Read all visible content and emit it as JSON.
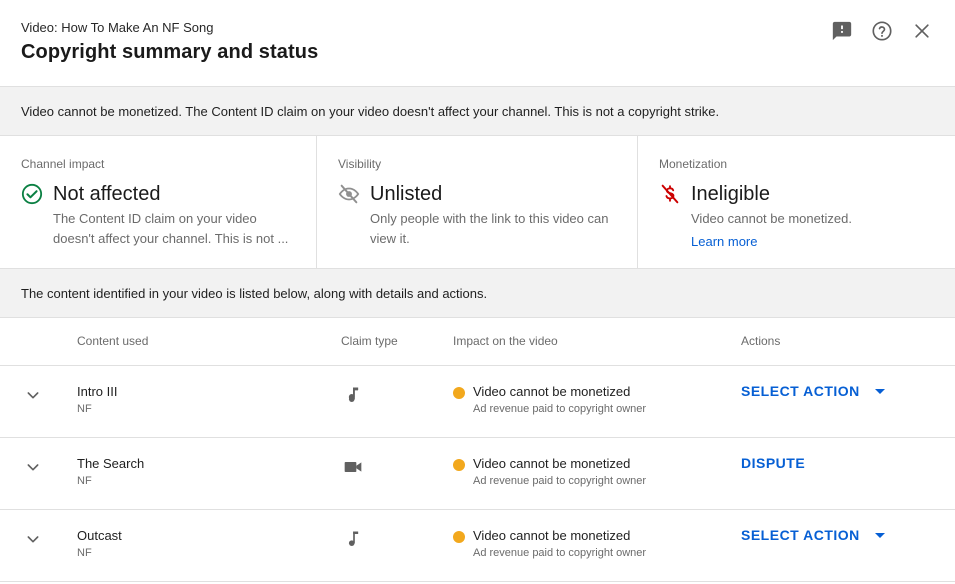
{
  "header": {
    "video_label": "Video: How To Make An NF Song",
    "title": "Copyright summary and status",
    "icons": [
      "feedback-icon",
      "help-icon",
      "close-icon"
    ]
  },
  "banner": {
    "text": "Video cannot be monetized. The Content ID claim on your video doesn't affect your channel. This is not a copyright strike."
  },
  "summary": {
    "channel": {
      "label": "Channel impact",
      "value": "Not affected",
      "desc": "The Content ID claim on your video doesn't affect your channel. This is not ...",
      "icon": "check-circle-icon",
      "icon_color": "#0b8043"
    },
    "visibility": {
      "label": "Visibility",
      "value": "Unlisted",
      "desc": "Only people with the link to this video can view it.",
      "icon": "eye-off-icon",
      "icon_color": "#909090"
    },
    "monetization": {
      "label": "Monetization",
      "value": "Ineligible",
      "desc": "Video cannot be monetized.",
      "link": "Learn more",
      "icon": "no-money-icon",
      "icon_color": "#cc0000"
    }
  },
  "content_band": {
    "text": "The content identified in your video is listed below, along with details and actions."
  },
  "table": {
    "headers": [
      "Content used",
      "Claim type",
      "Impact on the video",
      "Actions"
    ],
    "rows": [
      {
        "title": "Intro III",
        "artist": "NF",
        "claim_type": "audio-icon",
        "impact": "Video cannot be monetized",
        "impact_sub": "Ad revenue paid to copyright owner",
        "action": "SELECT ACTION",
        "has_dropdown": true
      },
      {
        "title": "The Search",
        "artist": "NF",
        "claim_type": "video-camera-icon",
        "impact": "Video cannot be monetized",
        "impact_sub": "Ad revenue paid to copyright owner",
        "action": "DISPUTE",
        "has_dropdown": false
      },
      {
        "title": "Outcast",
        "artist": "NF",
        "claim_type": "audio-icon",
        "impact": "Video cannot be monetized",
        "impact_sub": "Ad revenue paid to copyright owner",
        "action": "SELECT ACTION",
        "has_dropdown": true
      }
    ]
  },
  "colors": {
    "accent": "#065fd4",
    "status_warning": "#f2a81d",
    "band_background": "#f2f2f2"
  }
}
